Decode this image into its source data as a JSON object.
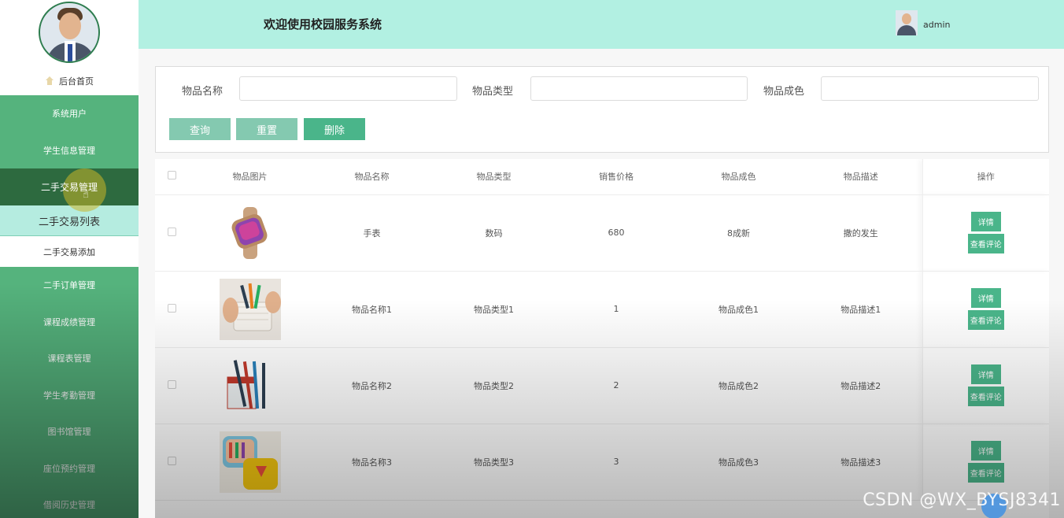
{
  "sidebar": {
    "home_label": "后台首页",
    "menu": [
      {
        "label": "系统用户"
      },
      {
        "label": "学生信息管理"
      },
      {
        "label": "二手交易管理"
      },
      {
        "label": "二手交易列表"
      },
      {
        "label": "二手交易添加"
      },
      {
        "label": "二手订单管理"
      },
      {
        "label": "课程成绩管理"
      },
      {
        "label": "课程表管理"
      },
      {
        "label": "学生考勤管理"
      },
      {
        "label": "图书馆管理"
      },
      {
        "label": "座位预约管理"
      },
      {
        "label": "借阅历史管理"
      }
    ]
  },
  "header": {
    "title": "欢迎使用校园服务系统",
    "username": "admin"
  },
  "search": {
    "fields": [
      {
        "label": "物品名称",
        "value": ""
      },
      {
        "label": "物品类型",
        "value": ""
      },
      {
        "label": "物品成色",
        "value": ""
      }
    ],
    "buttons": {
      "query": "查询",
      "reset": "重置",
      "delete": "删除"
    }
  },
  "table": {
    "headers": [
      "物品图片",
      "物品名称",
      "物品类型",
      "销售价格",
      "物品成色",
      "物品描述",
      "操作"
    ],
    "rows": [
      {
        "name": "手表",
        "type": "数码",
        "price": "680",
        "condition": "8成新",
        "desc": "撒的发生"
      },
      {
        "name": "物品名称1",
        "type": "物品类型1",
        "price": "1",
        "condition": "物品成色1",
        "desc": "物品描述1"
      },
      {
        "name": "物品名称2",
        "type": "物品类型2",
        "price": "2",
        "condition": "物品成色2",
        "desc": "物品描述2"
      },
      {
        "name": "物品名称3",
        "type": "物品类型3",
        "price": "3",
        "condition": "物品成色3",
        "desc": "物品描述3"
      }
    ],
    "op_detail": "详情",
    "op_comment": "查看评论"
  },
  "watermark": "CSDN @WX_BYSJ8341"
}
